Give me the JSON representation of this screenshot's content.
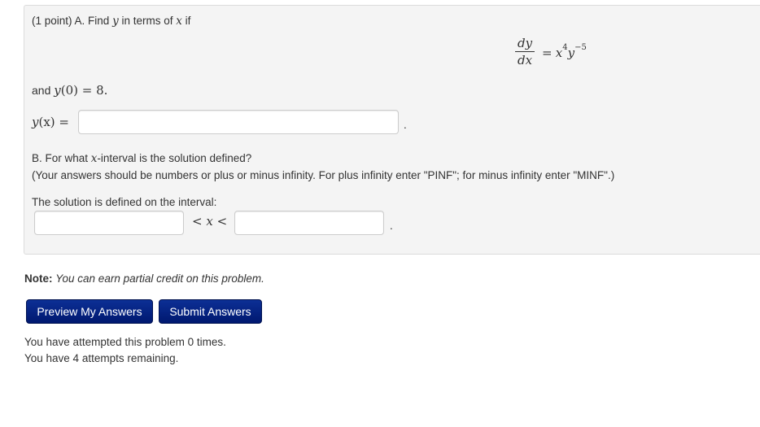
{
  "problem": {
    "part_a": {
      "intro_prefix": "(1 point) A. Find ",
      "intro_var_y": "y",
      "intro_middle": " in terms of ",
      "intro_var_x": "x",
      "intro_suffix": " if",
      "equation": {
        "numerator": "dy",
        "denominator": "dx",
        "equals": "=",
        "rhs_x": "x",
        "rhs_x_exp": "4",
        "rhs_y": "y",
        "rhs_y_exp": "−5"
      },
      "initial_condition_prefix": "and ",
      "initial_condition_y": "y",
      "initial_condition_rest": "(0) = 8.",
      "answer_label_y": "y",
      "answer_label_rest": "(x) =",
      "answer_value": "",
      "period": "."
    },
    "part_b": {
      "question_prefix": "B. For what ",
      "question_var": "x",
      "question_suffix": "-interval is the solution defined?",
      "instructions": "(Your answers should be numbers or plus or minus infinity. For plus infinity enter \"PINF\"; for minus infinity enter \"MINF\".)",
      "interval_label": "The solution is defined on the interval:",
      "lower_value": "",
      "inequality": "< x <",
      "upper_value": "",
      "period": "."
    }
  },
  "note": {
    "label": "Note:",
    "text": "You can earn partial credit on this problem."
  },
  "buttons": {
    "preview": "Preview My Answers",
    "submit": "Submit Answers"
  },
  "status": {
    "attempted": "You have attempted this problem 0 times.",
    "remaining": "You have 4 attempts remaining."
  },
  "colors": {
    "button_bg": "#0c2f95",
    "panel_bg": "#f4f4f4"
  }
}
